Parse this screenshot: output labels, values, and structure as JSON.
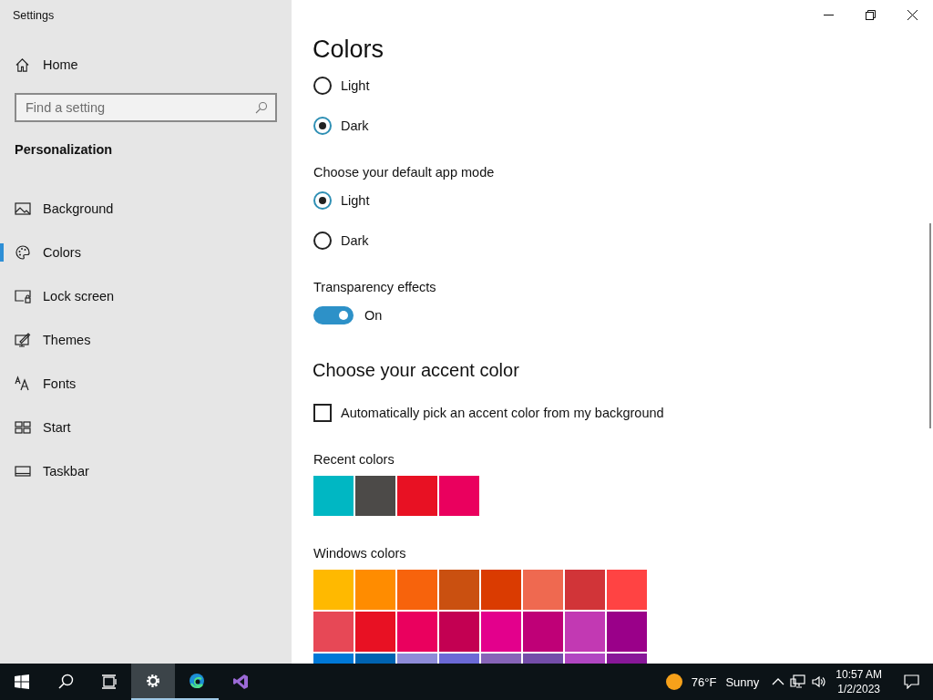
{
  "window": {
    "title": "Settings"
  },
  "sidebar": {
    "home": "Home",
    "search": {
      "placeholder": "Find a setting"
    },
    "section": "Personalization",
    "items": [
      {
        "label": "Background",
        "selected": false
      },
      {
        "label": "Colors",
        "selected": true
      },
      {
        "label": "Lock screen",
        "selected": false
      },
      {
        "label": "Themes",
        "selected": false
      },
      {
        "label": "Fonts",
        "selected": false
      },
      {
        "label": "Start",
        "selected": false
      },
      {
        "label": "Taskbar",
        "selected": false
      }
    ]
  },
  "content": {
    "title": "Colors",
    "items": [
      {
        "kind": "radio",
        "label": "Light",
        "selected": false
      },
      {
        "kind": "radio",
        "label": "Dark",
        "selected": true
      },
      {
        "kind": "label",
        "text": "Choose your default app mode"
      },
      {
        "kind": "radio",
        "label": "Light",
        "selected": true
      },
      {
        "kind": "radio",
        "label": "Dark",
        "selected": false
      },
      {
        "kind": "label",
        "text": "Transparency effects"
      },
      {
        "kind": "toggle",
        "on": true,
        "state": "On"
      },
      {
        "kind": "heading",
        "text": "Choose your accent color"
      },
      {
        "kind": "checkbox",
        "label": "Automatically pick an accent color from my background",
        "checked": false
      },
      {
        "kind": "label",
        "text": "Recent colors"
      },
      {
        "kind": "swatches",
        "swatches": [
          {
            "color": "#00b7c3"
          },
          {
            "color": "#4c4a48"
          },
          {
            "color": "#e81123"
          },
          {
            "color": "#ea005e"
          }
        ]
      },
      {
        "kind": "label",
        "text": "Windows colors"
      },
      {
        "kind": "swatches",
        "swatches": [
          {
            "color": "#ffb900"
          },
          {
            "color": "#ff8c00"
          },
          {
            "color": "#f7630c"
          },
          {
            "color": "#ca5010"
          },
          {
            "color": "#da3b01"
          },
          {
            "color": "#ef6950"
          },
          {
            "color": "#d13438"
          },
          {
            "color": "#ff4343"
          },
          {
            "color": "#e74856"
          },
          {
            "color": "#e81123"
          },
          {
            "color": "#ea005e"
          },
          {
            "color": "#c30052"
          },
          {
            "color": "#e3008c"
          },
          {
            "color": "#bf0077"
          },
          {
            "color": "#c239b3"
          },
          {
            "color": "#9a0089"
          },
          {
            "color": "#0078d7"
          },
          {
            "color": "#0063b1"
          },
          {
            "color": "#8e8cd8"
          },
          {
            "color": "#6b69d6"
          },
          {
            "color": "#8764b8"
          },
          {
            "color": "#744da9"
          },
          {
            "color": "#b146c2"
          },
          {
            "color": "#881798"
          }
        ]
      }
    ]
  },
  "taskbar": {
    "apps": [
      {
        "active": false,
        "open": false
      },
      {
        "active": false,
        "open": false
      },
      {
        "active": true,
        "open": true
      },
      {
        "active": false,
        "open": true
      },
      {
        "active": false,
        "open": false
      }
    ],
    "weather": {
      "temperature": "76°F",
      "condition": "Sunny"
    },
    "time": "10:57 AM",
    "date": "1/2/2023"
  }
}
